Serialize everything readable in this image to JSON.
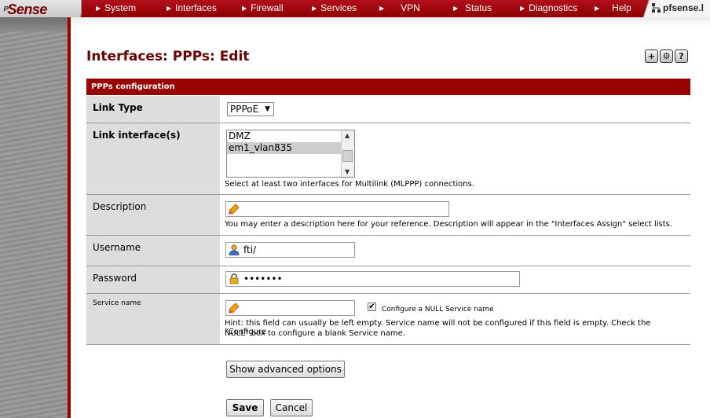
{
  "nav": {
    "logo": "Sense",
    "items": [
      "System",
      "Interfaces",
      "Firewall",
      "Services",
      "VPN",
      "Status",
      "Diagnostics",
      "Help"
    ],
    "hostname": "pfsense.l"
  },
  "page": {
    "title": "Interfaces: PPPs: Edit"
  },
  "header_icons": [
    "add-icon",
    "settings-icon",
    "help-icon"
  ],
  "section": {
    "title": "PPPs configuration"
  },
  "form": {
    "link_type": {
      "label": "Link Type",
      "value": "PPPoE"
    },
    "link_interfaces": {
      "label": "Link interface(s)",
      "options": [
        "DMZ",
        "em1_vlan835"
      ],
      "selected": "em1_vlan835",
      "hint": "Select at least two interfaces for Multilink (MLPPP) connections."
    },
    "description": {
      "label": "Description",
      "value": "",
      "hint": "You may enter a description here for your reference. Description will appear in the \"Interfaces Assign\" select lists."
    },
    "username": {
      "label": "Username",
      "value": "fti/"
    },
    "password": {
      "label": "Password",
      "value": "•••••••"
    },
    "service_name": {
      "label": "Service name",
      "value": "",
      "null_checked": true,
      "null_label": "Configure a NULL Service name",
      "hint_line1": "Hint: this field can usually be left empty. Service name will not be configured if this field is empty. Check the \"Configure",
      "hint_line2": "NULL\" box to configure a blank Service name."
    }
  },
  "buttons": {
    "advanced": "Show advanced options",
    "save": "Save",
    "cancel": "Cancel"
  }
}
